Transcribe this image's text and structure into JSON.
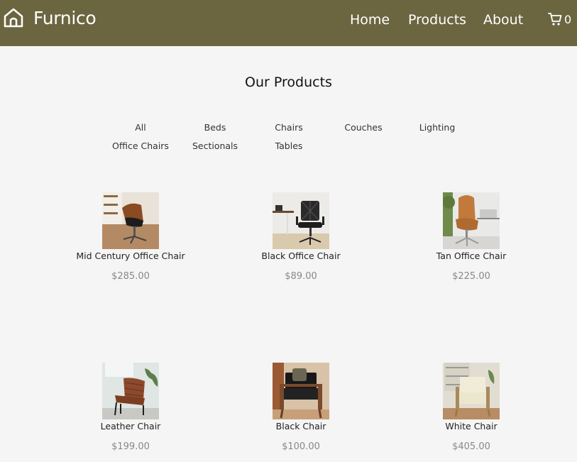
{
  "brand": {
    "name": "Furnico",
    "icon": "home-icon"
  },
  "nav": {
    "links": [
      "Home",
      "Products",
      "About"
    ],
    "cart_icon": "cart-icon",
    "cart_count": "0"
  },
  "page": {
    "title": "Our Products"
  },
  "filters": [
    "All",
    "Beds",
    "Chairs",
    "Couches",
    "Lighting",
    "Office Chairs",
    "Sectionals",
    "Tables"
  ],
  "products": [
    {
      "name": "Mid Century Office Chair",
      "price": "$285.00"
    },
    {
      "name": "Black Office Chair",
      "price": "$89.00"
    },
    {
      "name": "Tan Office Chair",
      "price": "$225.00"
    },
    {
      "name": "Leather Chair",
      "price": "$199.00"
    },
    {
      "name": "Black Chair",
      "price": "$100.00"
    },
    {
      "name": "White Chair",
      "price": "$405.00"
    }
  ],
  "colors": {
    "navbar": "#6b6640",
    "background": "#f5f5f5",
    "price": "#888888"
  }
}
